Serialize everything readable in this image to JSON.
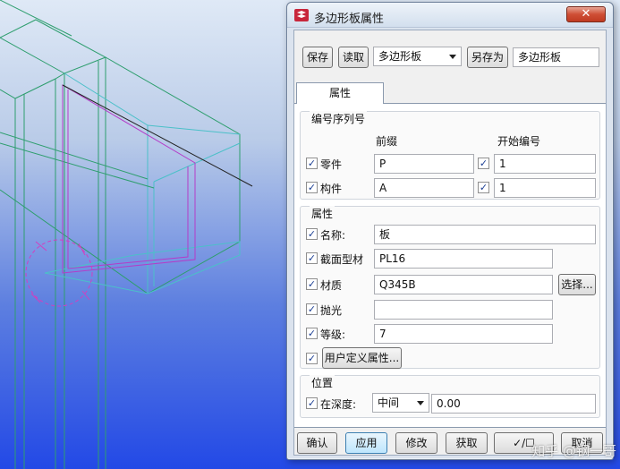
{
  "colors": {
    "structure_green": "#2e9e6e",
    "structure_cyan": "#4bc0c8",
    "selection_magenta": "#b43cc8",
    "bg_blue": "#2349e6"
  },
  "dialog": {
    "title": "多边形板属性",
    "close_symbol": "✕",
    "toolbar": {
      "save": "保存",
      "load": "读取",
      "preset_value": "多边形板",
      "save_as": "另存为",
      "save_as_name": "多边形板"
    },
    "tab": "属性",
    "numbering": {
      "title": "编号序列号",
      "prefix_header": "前缀",
      "start_header": "开始编号",
      "part_label": "零件",
      "part_prefix": "P",
      "part_start": "1",
      "assembly_label": "构件",
      "assembly_prefix": "A",
      "assembly_start": "1"
    },
    "attributes": {
      "title": "属性",
      "name_label": "名称:",
      "name_value": "板",
      "profile_label": "截面型材",
      "profile_value": "PL16",
      "material_label": "材质",
      "material_value": "Q345B",
      "material_button": "选择...",
      "finish_label": "抛光",
      "finish_value": "",
      "class_label": "等级:",
      "class_value": "7",
      "udf_button": "用户定义属性..."
    },
    "position": {
      "title": "位置",
      "depth_label": "在深度:",
      "depth_option": "中间",
      "depth_value": "0.00"
    },
    "footer": {
      "ok": "确认",
      "apply": "应用",
      "modify": "修改",
      "get": "获取",
      "toggle": "✓/☐",
      "cancel": "取消"
    },
    "check_mark": "✓"
  },
  "watermark": "知乎 @钢一哥"
}
